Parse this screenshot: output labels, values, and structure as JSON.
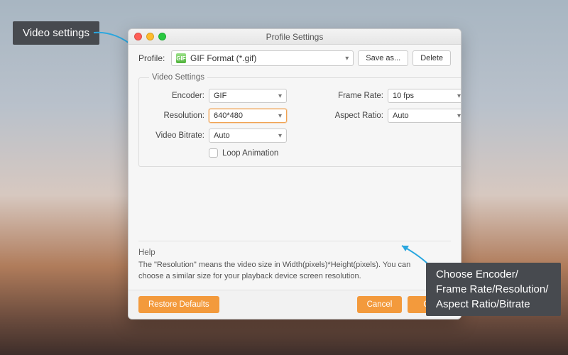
{
  "annotations": {
    "left": "Video settings",
    "right": "Choose Encoder/ Frame Rate/Resolution/ Aspect Ratio/Bitrate"
  },
  "window": {
    "title": "Profile Settings",
    "profile": {
      "label": "Profile:",
      "value": "GIF Format (*.gif)",
      "save_as": "Save as...",
      "delete": "Delete"
    },
    "video_group": {
      "legend": "Video Settings",
      "encoder_label": "Encoder:",
      "encoder": "GIF",
      "resolution_label": "Resolution:",
      "resolution": "640*480",
      "bitrate_label": "Video Bitrate:",
      "bitrate": "Auto",
      "framerate_label": "Frame Rate:",
      "framerate": "10 fps",
      "aspect_label": "Aspect Ratio:",
      "aspect": "Auto",
      "loop_label": "Loop Animation"
    },
    "help": {
      "legend": "Help",
      "text": "The \"Resolution\" means the video size in Width(pixels)*Height(pixels).  You can choose a similar size for your playback device screen resolution."
    },
    "footer": {
      "restore": "Restore Defaults",
      "cancel": "Cancel",
      "ok": "OK"
    }
  }
}
